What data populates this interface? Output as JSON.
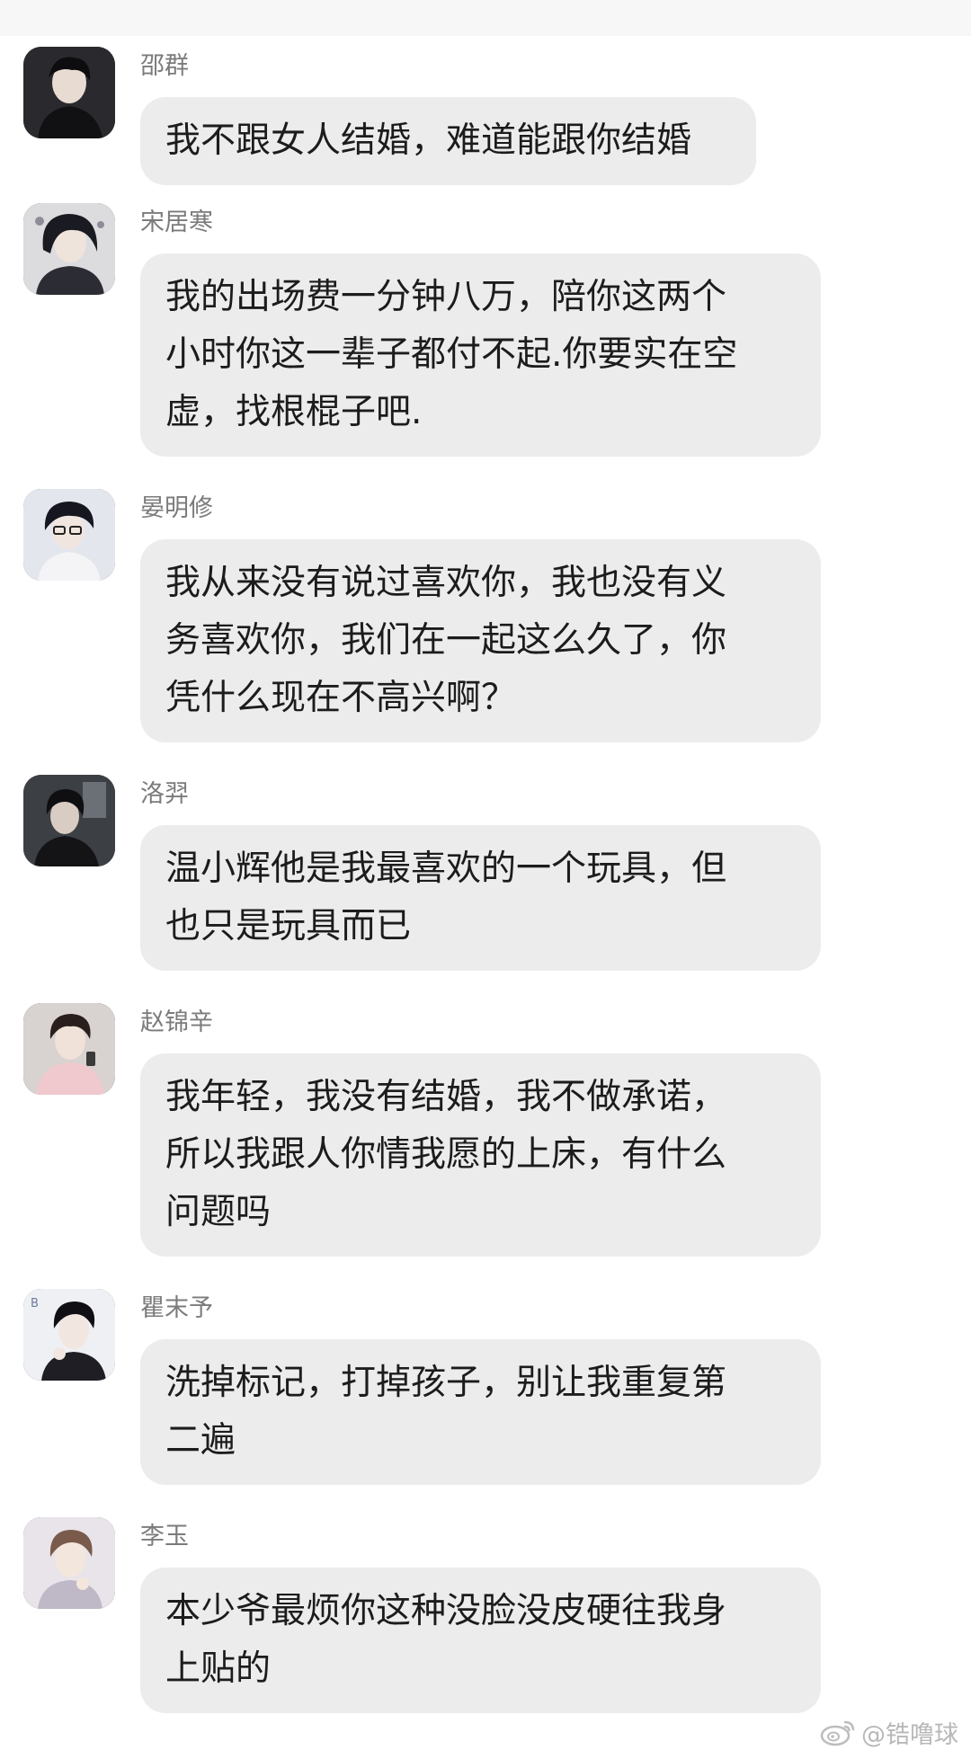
{
  "messages": [
    {
      "name": "邵群",
      "text": "我不跟女人结婚，难道能跟你结婚"
    },
    {
      "name": "宋居寒",
      "text": "我的出场费一分钟八万，陪你这两个\n小时你这一辈子都付不起.你要实在空\n虚，找根棍子吧."
    },
    {
      "name": "晏明修",
      "text": "我从来没有说过喜欢你，我也没有义\n务喜欢你，我们在一起这么久了，你\n凭什么现在不高兴啊？"
    },
    {
      "name": "洛羿",
      "text": "温小辉他是我最喜欢的一个玩具，但\n也只是玩具而已"
    },
    {
      "name": "赵锦辛",
      "text": "我年轻，我没有结婚，我不做承诺，\n所以我跟人你情我愿的上床，有什么\n问题吗"
    },
    {
      "name": "瞿末予",
      "text": "洗掉标记，打掉孩子，别让我重复第\n二遍"
    },
    {
      "name": "李玉",
      "text": "本少爷最烦你这种没脸没皮硬往我身\n上贴的"
    }
  ],
  "watermark": {
    "text": "@锆噜球",
    "icon": "weibo-icon"
  },
  "colors": {
    "bubble": "#ececec",
    "name": "#7b7b7b",
    "text": "#1c1c1c",
    "topbar": "#f7f7f7"
  }
}
